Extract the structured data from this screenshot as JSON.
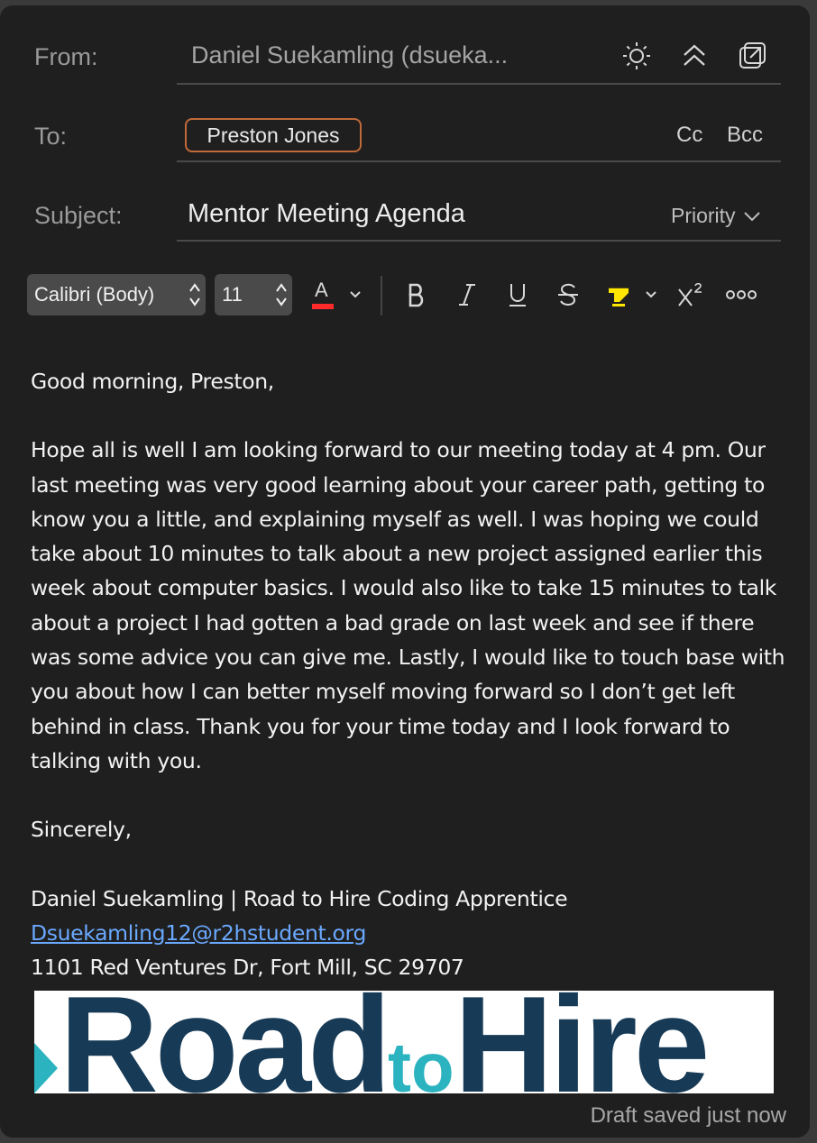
{
  "header": {
    "from_label": "From:",
    "from_value": "Daniel Suekamling (dsueka...",
    "to_label": "To:",
    "to_recipient": "Preston Jones",
    "cc_label": "Cc",
    "bcc_label": "Bcc",
    "subject_label": "Subject:",
    "subject_value": "Mentor Meeting Agenda",
    "priority_label": "Priority"
  },
  "toolbar": {
    "font_family": "Calibri (Body)",
    "font_size": "11",
    "font_color_letter": "A",
    "font_color": "#ff2b2b",
    "highlight_color": "#ffe600",
    "icons": [
      "sun-icon",
      "collapse-icon",
      "popout-icon",
      "bold-icon",
      "italic-icon",
      "underline-icon",
      "strikethrough-icon",
      "highlighter-icon",
      "superscript-icon",
      "more-icon"
    ]
  },
  "body": {
    "greeting": "Good morning, Preston,",
    "paragraph": "Hope all is well I am looking forward to our meeting today at 4 pm. Our last meeting was very good learning about your career path, getting to know you a little, and explaining myself as well. I was hoping we could take about 10 minutes to talk about a new project assigned earlier this week about computer basics. I would also like to take 15 minutes to talk about a project I had gotten a bad grade on last week and see if there was some advice you can give me. Lastly, I would like to touch base with you about how I can better myself moving forward so I don’t get left behind in class. Thank you for your time today and I look forward to talking with you.",
    "closing": "Sincerely,",
    "signature_name": "Daniel Suekamling | Road to Hire Coding Apprentice",
    "signature_email": "Dsuekamling12@r2hstudent.org",
    "signature_address": "1101 Red Ventures Dr, Fort Mill, SC 29707"
  },
  "logo": {
    "part1": "Road",
    "part2": "to",
    "part3": "Hire"
  },
  "status": "Draft saved just now"
}
